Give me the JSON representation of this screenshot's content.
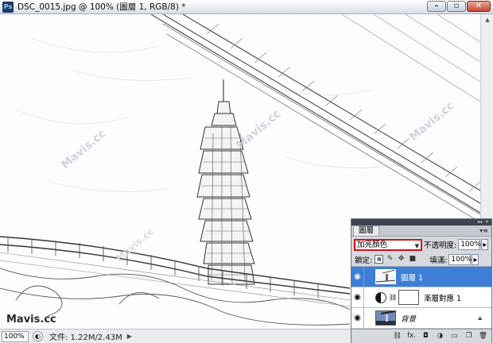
{
  "window": {
    "title": "DSC_0015.jpg @ 100% (圖層 1, RGB/8) *",
    "app_icon": "ps-app-icon",
    "app_icon_label": "Ps",
    "minimize_glyph": "–",
    "maximize_glyph": "▫",
    "close_glyph": "✕"
  },
  "canvas": {
    "watermarks": [
      "Mavis.cc",
      "Mavis.cc",
      "Mavis.cc",
      "Mavis.cc"
    ],
    "signature": "Mavis.cc"
  },
  "status_bar": {
    "zoom": "100%",
    "file_info": "文件: 1.22M/2.43M",
    "menu_arrow": "▶"
  },
  "layers_panel": {
    "tab_label": "圖層",
    "blend_mode": "加亮顏色",
    "opacity_label": "不透明度:",
    "opacity_value": "100%",
    "lock_label": "鎖定:",
    "fill_label": "填滿:",
    "fill_value": "100%",
    "layers": [
      {
        "name": "圖層 1",
        "selected": true,
        "visible": true,
        "italic": false
      },
      {
        "name": "漸層對應 1",
        "selected": false,
        "visible": true,
        "italic": false
      },
      {
        "name": "背景",
        "selected": false,
        "visible": true,
        "italic": true
      }
    ],
    "bottom_icons": [
      "link-icon",
      "fx-icon",
      "mask-icon",
      "adjustment-icon",
      "group-icon",
      "new-layer-icon",
      "trash-icon"
    ],
    "fx_label": "fx."
  },
  "colors": {
    "selection_blue": "#3d7fd6",
    "highlight_red": "#d0141c",
    "panel_gray": "#d6d9de"
  }
}
